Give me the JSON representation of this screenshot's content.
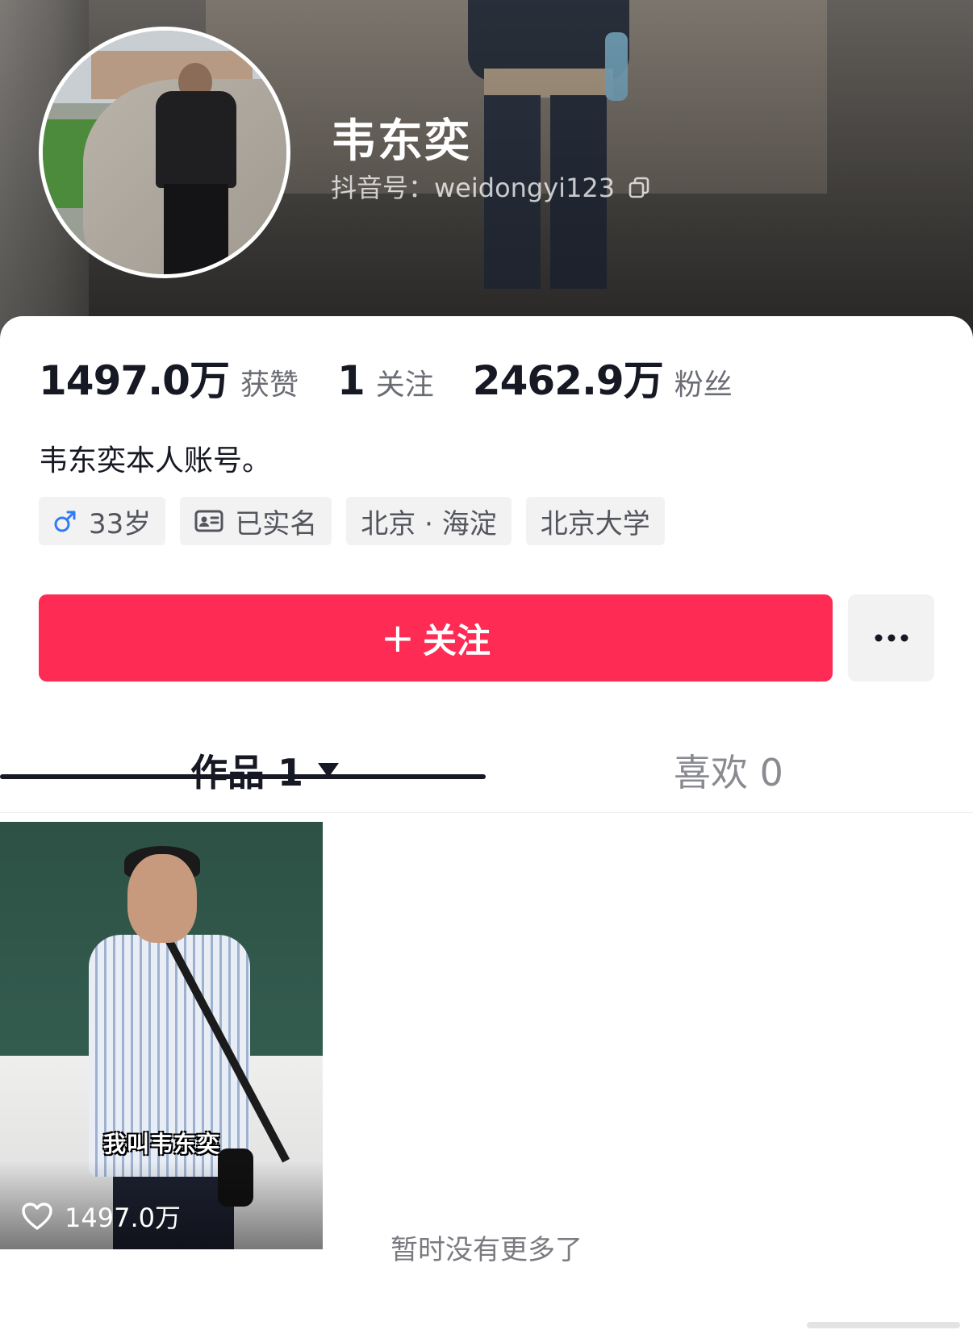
{
  "profile": {
    "name": "韦东奕",
    "douyin_id": "抖音号：weidongyi123",
    "bio": "韦东奕本人账号。"
  },
  "stats": [
    {
      "value": "1497.0万",
      "label": "获赞"
    },
    {
      "value": "1",
      "label": "关注"
    },
    {
      "value": "2462.9万",
      "label": "粉丝"
    }
  ],
  "tags": {
    "age": "33岁",
    "verified": "已实名",
    "location": "北京 · 海淀",
    "school": "北京大学"
  },
  "actions": {
    "follow_plus": "+",
    "follow_label": "关注"
  },
  "tabs": {
    "works": "作品 1",
    "likes": "喜欢 0"
  },
  "video": {
    "caption": "我叫韦东奕",
    "like_count": "1497.0万"
  },
  "footer": {
    "no_more": "暂时没有更多了"
  },
  "colors": {
    "accent": "#fe2c55",
    "male_icon": "#2f7cf6"
  },
  "icons": [
    "copy-icon",
    "male-icon",
    "id-card-icon",
    "more-dots-icon",
    "dropdown-caret-icon",
    "heart-icon"
  ]
}
